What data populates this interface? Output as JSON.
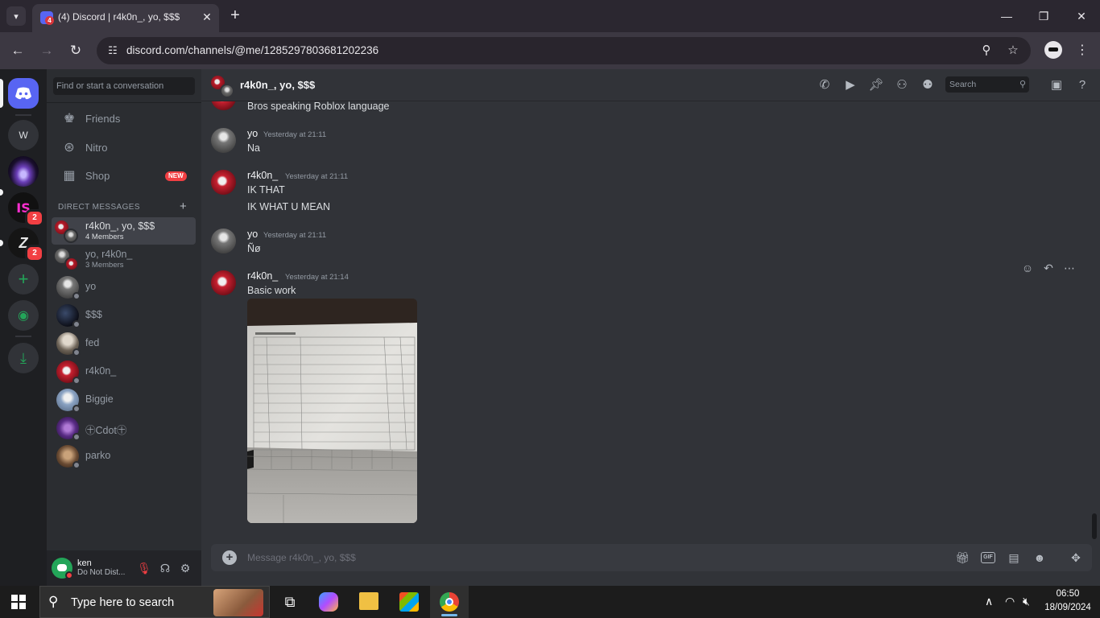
{
  "browser": {
    "tab_title": "(4) Discord | r4k0n_, yo, $$$",
    "favicon_badge": "4",
    "url": "discord.com/channels/@me/1285297803681202236"
  },
  "sidebar": {
    "search_placeholder": "Find or start a conversation",
    "nav": [
      {
        "label": "Friends",
        "icon": "friends-icon"
      },
      {
        "label": "Nitro",
        "icon": "nitro-icon"
      },
      {
        "label": "Shop",
        "icon": "shop-icon",
        "badge": "NEW"
      }
    ],
    "dm_header": "DIRECT MESSAGES",
    "dms": [
      {
        "name": "r4k0n_, yo, $$$",
        "sub": "4 Members",
        "active": true
      },
      {
        "name": "yo, r4k0n_",
        "sub": "3 Members"
      },
      {
        "name": "yo"
      },
      {
        "name": "$$$"
      },
      {
        "name": "fed"
      },
      {
        "name": "r4k0n_"
      },
      {
        "name": "Biggie"
      },
      {
        "name": "㊉Cdot㊉"
      },
      {
        "name": "parko"
      }
    ]
  },
  "guilds": {
    "items": [
      {
        "label": "W"
      },
      {
        "badge": "2"
      },
      {
        "badge": "2"
      }
    ]
  },
  "user": {
    "name": "ken",
    "status": "Do Not Dist..."
  },
  "chat": {
    "title": "r4k0n_, yo, $$$",
    "search_placeholder": "Search",
    "messages": [
      {
        "author": "",
        "time": "",
        "lines": [
          "Bros speaking Roblox language"
        ]
      },
      {
        "author": "yo",
        "time": "Yesterday at 21:11",
        "lines": [
          "Na"
        ]
      },
      {
        "author": "r4k0n_",
        "time": "Yesterday at 21:11",
        "lines": [
          "IK THAT",
          "IK WHAT U MEAN"
        ]
      },
      {
        "author": "yo",
        "time": "Yesterday at 21:11",
        "lines": [
          "Ñø"
        ]
      },
      {
        "author": "r4k0n_",
        "time": "Yesterday at 21:14",
        "lines": [
          "Basic work"
        ]
      }
    ],
    "composer_placeholder": "Message r4k0n_, yo, $$$"
  },
  "taskbar": {
    "search_placeholder": "Type here to search",
    "time": "06:50",
    "date": "18/09/2024"
  },
  "colors": {
    "blurple": "#5865f2",
    "dnd_red": "#f23f43",
    "green": "#23a559"
  }
}
